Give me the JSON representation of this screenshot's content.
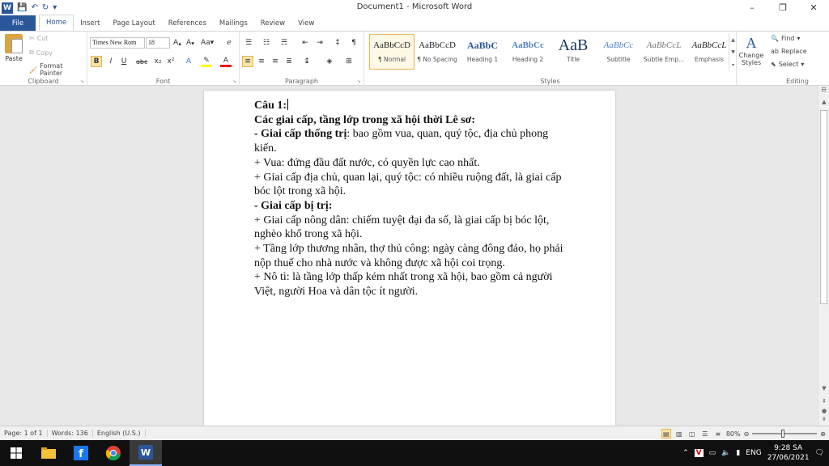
{
  "window": {
    "title": "Document1 - Microsoft Word",
    "minimize": "–",
    "restore": "❐",
    "close": "✕"
  },
  "tabs": [
    "File",
    "Home",
    "Insert",
    "Page Layout",
    "References",
    "Mailings",
    "Review",
    "View"
  ],
  "ribbon": {
    "clipboard": {
      "paste": "Paste",
      "cut": "Cut",
      "copy": "Copy",
      "format_painter": "Format Painter",
      "label": "Clipboard"
    },
    "font": {
      "name": "Times New Rom",
      "size": "18",
      "label": "Font"
    },
    "paragraph": {
      "label": "Paragraph"
    },
    "styles": {
      "label": "Styles",
      "items": [
        {
          "preview": "AaBbCcD",
          "name": "¶ Normal"
        },
        {
          "preview": "AaBbCcD",
          "name": "¶ No Spacing"
        },
        {
          "preview": "AaBbC",
          "name": "Heading 1"
        },
        {
          "preview": "AaBbCc",
          "name": "Heading 2"
        },
        {
          "preview": "AaB",
          "name": "Title"
        },
        {
          "preview": "AaBbCc",
          "name": "Subtitle"
        },
        {
          "preview": "AaBbCcL",
          "name": "Subtle Emp..."
        },
        {
          "preview": "AaBbCcL",
          "name": "Emphasis"
        }
      ],
      "change_styles": "Change Styles"
    },
    "editing": {
      "find": "Find",
      "replace": "Replace",
      "select": "Select",
      "label": "Editing"
    }
  },
  "document": {
    "lines": [
      {
        "bold": "Câu 1:",
        "rest": ""
      },
      {
        "bold": "Các giai cấp, tầng lớp trong xã hội thời Lê sơ:",
        "rest": ""
      },
      {
        "bold": "- Giai cấp thống trị",
        "rest": ": bao gồm vua, quan, quý tộc, địa chủ phong kiến."
      },
      {
        "bold": "",
        "rest": "+ Vua: đứng đầu đất nước, có quyền lực cao nhất."
      },
      {
        "bold": "",
        "rest": "+ Giai cấp địa chủ, quan lại, quý tộc: có nhiều ruộng đất, là giai cấp bóc lột trong xã hội."
      },
      {
        "bold": "- Giai cấp bị trị:",
        "rest": ""
      },
      {
        "bold": "",
        "rest": "+ Giai cấp nông dân: chiếm tuyệt đại đa số, là giai cấp bị bóc lột, nghèo khổ trong xã hội."
      },
      {
        "bold": "",
        "rest": "+ Tầng lớp thương nhân, thợ thủ công: ngày càng đông đảo, họ phải nộp thuế cho nhà nước và không được xã hội coi trọng."
      },
      {
        "bold": "",
        "rest": "+ Nô tì: là tầng lớp thấp kém nhất trong xã hội, bao gồm cả người Việt, người Hoa và dân tộc ít người."
      }
    ]
  },
  "status": {
    "page": "Page: 1 of 1",
    "words": "Words: 136",
    "language": "English (U.S.)",
    "zoom": "80%"
  },
  "taskbar": {
    "lang": "ENG",
    "time": "9:28 SA",
    "date": "27/06/2021"
  }
}
